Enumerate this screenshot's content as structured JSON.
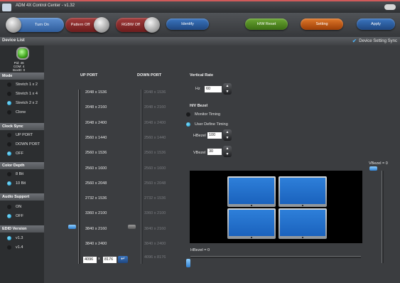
{
  "window": {
    "title": "ADM 4X Control Center - v1.32"
  },
  "toolbar": {
    "turn_on": "Turn On",
    "pattern_off": "Pattern Off",
    "rgbw_off": "RGBW Off",
    "identify": "Identify",
    "hw_reset": "H/W Reset",
    "setting": "Setting",
    "apply": "Apply"
  },
  "device_list": {
    "title": "Device List",
    "sync_label": "Device Setting Sync",
    "pid": "Pid: 46",
    "com": "COM: 4",
    "boxid": "BoxID: 0"
  },
  "mode": {
    "title": "Mode",
    "options": [
      "Stretch 1 x 2",
      "Stretch 1 x 4",
      "Stretch 2 x 2",
      "Clone"
    ],
    "selected": 2
  },
  "clock_sync": {
    "title": "Clock Sync",
    "options": [
      "UP PORT",
      "DOWN PORT",
      "OFF"
    ],
    "selected": 2
  },
  "color_depth": {
    "title": "Color Depth",
    "options": [
      "8 Bit",
      "10 Bit"
    ],
    "selected": 1
  },
  "audio_support": {
    "title": "Audio Support",
    "options": [
      "ON",
      "OFF"
    ],
    "selected": 1
  },
  "edid_version": {
    "title": "EDID Version",
    "options": [
      "v1.3",
      "v1.4"
    ],
    "selected": 0
  },
  "up_port": {
    "title": "UP PORT",
    "resolutions": [
      "2048 x 1536",
      "2048 x 2160",
      "2048 x 2400",
      "2560 x 1440",
      "2560 x 1536",
      "2560 x 1600",
      "2560 x 2048",
      "2732 x 1536",
      "3360 x 2100",
      "3840 x 2160",
      "3840 x 2400"
    ],
    "selected": 9,
    "custom_w": "4096",
    "custom_x": "x",
    "custom_h": "8176"
  },
  "down_port": {
    "title": "DOWN PORT",
    "resolutions": [
      "2048 x 1536",
      "2048 x 2160",
      "2048 x 2400",
      "2560 x 1440",
      "2560 x 1536",
      "2560 x 1600",
      "2560 x 2048",
      "2732 x 1536",
      "3360 x 2100",
      "3840 x 2160",
      "3840 x 2400",
      "4096 x 8176"
    ]
  },
  "vertical_rate": {
    "title": "Vertical Rate",
    "label": "Hz",
    "value": "60"
  },
  "bezel": {
    "title": "H/V Bezel",
    "monitor_timing": "Monitor Timing",
    "user_define": "User Define Timing",
    "hbezel_label": "HBezel",
    "hbezel_value": "100",
    "vbezel_label": "VBezel",
    "vbezel_value": "30",
    "vbezel_readout": "VBezel = 0",
    "hbezel_readout": "HBezel = 0"
  },
  "colors": {
    "accent": "#1593c8",
    "turn_on": "#4a78b8",
    "pattern_off": "#8a2a2a",
    "rgbw_off": "#8a2a2a",
    "identify": "#2a5fa0",
    "hw_reset": "#4f8a1f",
    "setting": "#c85a10",
    "apply": "#2a5fa0"
  }
}
